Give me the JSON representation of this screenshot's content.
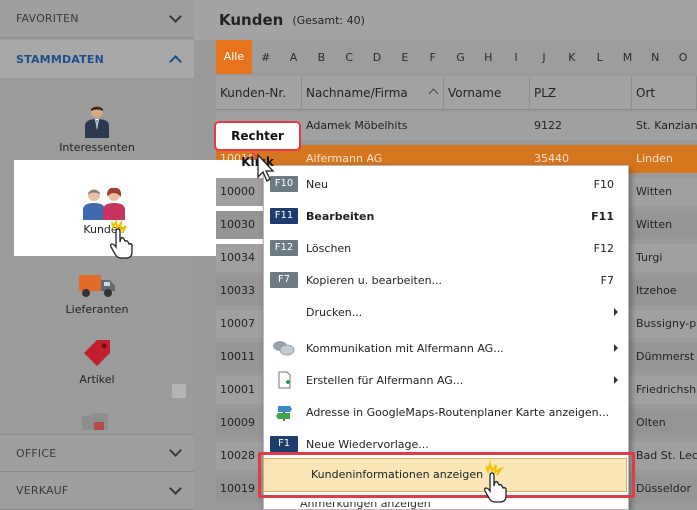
{
  "sidebar": {
    "sections": {
      "favoriten": "FAVORITEN",
      "stammdaten": "STAMMDATEN",
      "office": "OFFICE",
      "verkauf": "VERKAUF"
    },
    "items": [
      {
        "label": "Interessenten",
        "icon": "person-suit-icon"
      },
      {
        "label": "Kunden",
        "icon": "customers-icon"
      },
      {
        "label": "Lieferanten",
        "icon": "truck-icon"
      },
      {
        "label": "Artikel",
        "icon": "price-tag-icon"
      }
    ]
  },
  "header": {
    "title": "Kunden",
    "count": "(Gesamt: 40)"
  },
  "alphabet": [
    "Alle",
    "#",
    "A",
    "B",
    "C",
    "D",
    "E",
    "F",
    "G",
    "H",
    "I",
    "J",
    "K",
    "L",
    "M",
    "N",
    "O"
  ],
  "table": {
    "columns": [
      "Kunden-Nr.",
      "Nachname/Firma",
      "Vorname",
      "PLZ",
      "Ort"
    ],
    "rows": [
      {
        "nr": "",
        "name": "Adamek Möbelhits",
        "vorname": "",
        "plz": "9122",
        "ort": "St. Kanzian"
      },
      {
        "nr": "10010",
        "name": "Alfermann AG",
        "vorname": "",
        "plz": "35440",
        "ort": "Linden"
      },
      {
        "nr": "10000",
        "name": "",
        "vorname": "",
        "plz": "",
        "ort": "Witten"
      },
      {
        "nr": "10030",
        "name": "",
        "vorname": "",
        "plz": "",
        "ort": "Witten"
      },
      {
        "nr": "10034",
        "name": "",
        "vorname": "",
        "plz": "",
        "ort": "Turgi"
      },
      {
        "nr": "10033",
        "name": "",
        "vorname": "",
        "plz": "",
        "ort": "Itzehoe"
      },
      {
        "nr": "10007",
        "name": "",
        "vorname": "",
        "plz": "",
        "ort": "Bussigny-p"
      },
      {
        "nr": "10011",
        "name": "",
        "vorname": "",
        "plz": "",
        "ort": "Dümmerst"
      },
      {
        "nr": "10001",
        "name": "",
        "vorname": "",
        "plz": "",
        "ort": "Friedrichsh"
      },
      {
        "nr": "10009",
        "name": "",
        "vorname": "",
        "plz": "",
        "ort": "Olten"
      },
      {
        "nr": "10028",
        "name": "",
        "vorname": "",
        "plz": "",
        "ort": "Bad St. Lec"
      },
      {
        "nr": "10019",
        "name": "",
        "vorname": "",
        "plz": "",
        "ort": "Düsseldor"
      }
    ]
  },
  "callout": "Rechter Klick",
  "context_menu": {
    "items": [
      {
        "key": "F10",
        "label": "Neu",
        "shortcut": "F10"
      },
      {
        "key": "F11",
        "label": "Bearbeiten",
        "shortcut": "F11"
      },
      {
        "key": "F12",
        "label": "Löschen",
        "shortcut": "F12"
      },
      {
        "key": "F7",
        "label": "Kopieren u. bearbeiten...",
        "shortcut": "F7"
      },
      {
        "key": "",
        "label": "Drucken...",
        "shortcut": ""
      },
      {
        "key": "",
        "label": "Kommunikation mit Alfermann AG...",
        "shortcut": ""
      },
      {
        "key": "",
        "label": "Erstellen für Alfermann AG...",
        "shortcut": ""
      },
      {
        "key": "",
        "label": "Adresse in GoogleMaps-Routenplaner Karte anzeigen...",
        "shortcut": ""
      },
      {
        "key": "F1",
        "label": "Neue Wiedervorlage...",
        "shortcut": ""
      },
      {
        "key": "",
        "label": "Kundeninformationen anzeigen",
        "shortcut": ""
      },
      {
        "key": "",
        "label": "Anmerkungen anzeigen",
        "shortcut": ""
      }
    ]
  },
  "colors": {
    "accent_orange": "#e8731d",
    "highlight_red": "#e23b45",
    "section_blue": "#1d4f8c"
  }
}
